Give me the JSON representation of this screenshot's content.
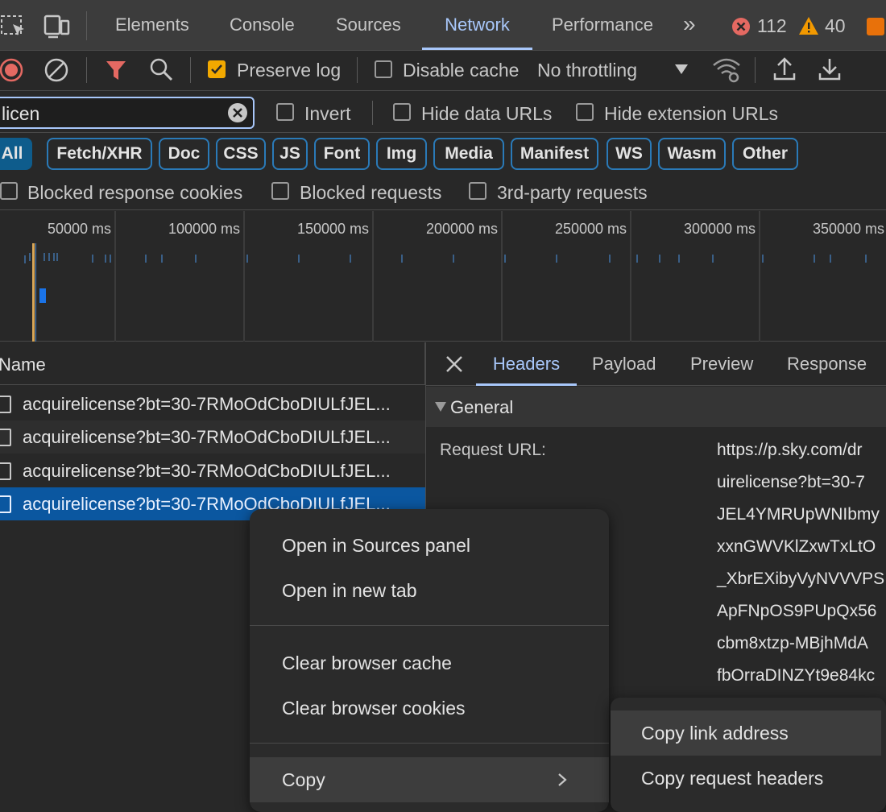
{
  "tabs": {
    "items": [
      "Elements",
      "Console",
      "Sources",
      "Network",
      "Performance"
    ],
    "active": "Network",
    "error_count": "112",
    "warning_count": "40"
  },
  "toolbar": {
    "preserve_log": "Preserve log",
    "preserve_log_checked": true,
    "disable_cache": "Disable cache",
    "throttling": "No throttling"
  },
  "filter": {
    "value": "licen",
    "invert": "Invert",
    "hide_data_urls": "Hide data URLs",
    "hide_extension_urls": "Hide extension URLs"
  },
  "types": [
    "All",
    "Fetch/XHR",
    "Doc",
    "CSS",
    "JS",
    "Font",
    "Img",
    "Media",
    "Manifest",
    "WS",
    "Wasm",
    "Other"
  ],
  "blocked": {
    "response_cookies": "Blocked response cookies",
    "requests": "Blocked requests",
    "third_party": "3rd-party requests"
  },
  "timeline": {
    "labels": [
      "50000 ms",
      "100000 ms",
      "150000 ms",
      "200000 ms",
      "250000 ms",
      "300000 ms",
      "350000 ms"
    ]
  },
  "requests": {
    "header": "Name",
    "rows": [
      "acquirelicense?bt=30-7RMoOdCboDIULfJEL...",
      "acquirelicense?bt=30-7RMoOdCboDIULfJEL...",
      "acquirelicense?bt=30-7RMoOdCboDIULfJEL...",
      "acquirelicense?bt=30-7RMoOdCboDIULfJEL..."
    ]
  },
  "detail": {
    "tabs": [
      "Headers",
      "Payload",
      "Preview",
      "Response"
    ],
    "active": "Headers",
    "section": "General",
    "request_url_label": "Request URL:",
    "url_lines": [
      "https://p.sky.com/dr",
      "uirelicense?bt=30-7",
      "JEL4YMRUpWNIbmy",
      "xxnGWVKlZxwTxLtO",
      "_XbrEXibyVyNVVVPS",
      "ApFNpOS9PUpQx56",
      "cbm8xtzp-MBjhMdA",
      "fbOrraDINZYt9e84kc"
    ]
  },
  "context_menu": {
    "open_sources": "Open in Sources panel",
    "open_new_tab": "Open in new tab",
    "clear_cache": "Clear browser cache",
    "clear_cookies": "Clear browser cookies",
    "copy": "Copy"
  },
  "copy_submenu": {
    "copy_link": "Copy link address",
    "copy_request_headers": "Copy request headers"
  }
}
